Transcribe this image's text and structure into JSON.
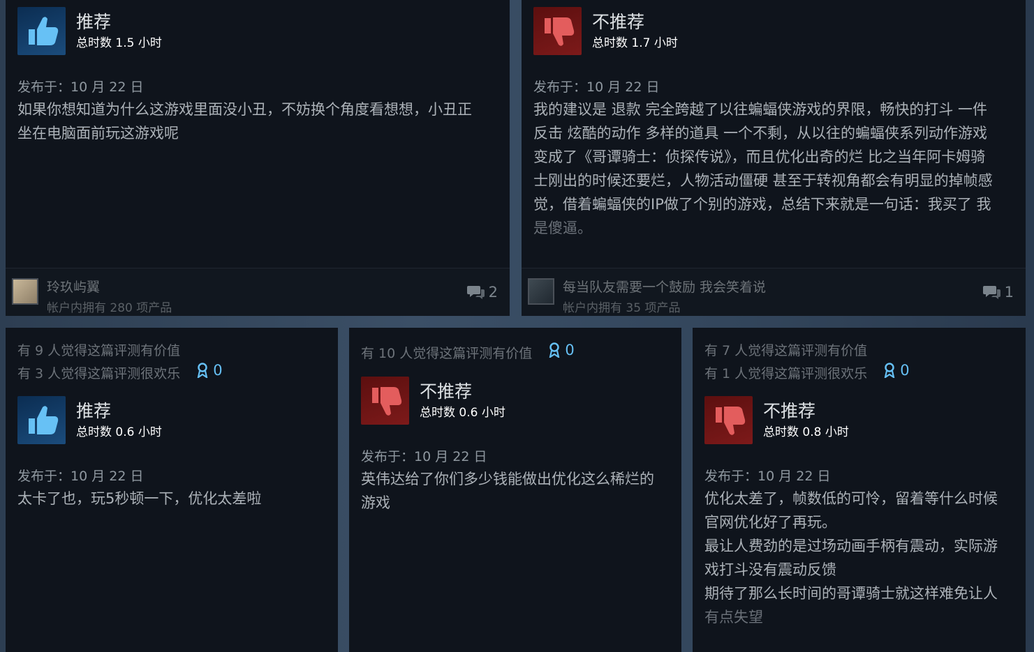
{
  "reviews_top": [
    {
      "verdict": "推荐",
      "hours": "总时数 1.5 小时",
      "posted": "发布于：10 月 22 日",
      "body": "如果你想知道为什么这游戏里面没小丑，不妨换个角度看想想，小丑正\n坐在电脑面前玩这游戏呢",
      "author": "玲玖屿翼",
      "products": "帐户内拥有 280 项产品",
      "comments": "2"
    },
    {
      "verdict": "不推荐",
      "hours": "总时数 1.7 小时",
      "posted": "发布于：10 月 22 日",
      "body": "我的建议是 退款 完全跨越了以往蝙蝠侠游戏的界限，畅快的打斗 一件\n反击 炫酷的动作 多样的道具 一个不剩，从以往的蝙蝠侠系列动作游戏\n变成了《哥谭骑士：侦探传说》，而且优化出奇的烂 比之当年阿卡姆骑\n士刚出的时候还要烂，人物活动僵硬 甚至于转视角都会有明显的掉帧感\n觉，借着蝙蝠侠的IP做了个别的游戏，总结下来就是一句话：我买了 我",
      "body_fade": "是傻逼。",
      "author": "每当队友需要一个鼓励 我会笑着说",
      "products": "帐户内拥有 35 项产品",
      "comments": "1"
    }
  ],
  "reviews_bottom": [
    {
      "helpful": "有 9 人觉得这篇评测有价值",
      "funny": "有 3 人觉得这篇评测很欢乐",
      "awards": "0",
      "verdict": "推荐",
      "hours": "总时数 0.6 小时",
      "posted": "发布于：10 月 22 日",
      "body": "太卡了也，玩5秒顿一下，优化太差啦"
    },
    {
      "helpful": "有 10 人觉得这篇评测有价值",
      "awards": "0",
      "verdict": "不推荐",
      "hours": "总时数 0.6 小时",
      "posted": "发布于：10 月 22 日",
      "body": "英伟达给了你们多少钱能做出优化这么稀烂的\n游戏"
    },
    {
      "helpful": "有 7 人觉得这篇评测有价值",
      "funny": "有 1 人觉得这篇评测很欢乐",
      "awards": "0",
      "verdict": "不推荐",
      "hours": "总时数 0.8 小时",
      "posted": "发布于：10 月 22 日",
      "body": "优化太差了，帧数低的可怜，留着等什么时候\n官网优化好了再玩。\n最让人费劲的是过场动画手柄有震动，实际游\n戏打斗没有震动反馈\n期待了那么长时间的哥谭骑士就这样难免让人",
      "body_fade": "有点失望"
    }
  ],
  "colors": {
    "card_bg": "#0f141c",
    "accent_blue": "#66c0f4",
    "thumb_up": "#1b4c7c",
    "thumb_down": "#7d1a1a"
  }
}
